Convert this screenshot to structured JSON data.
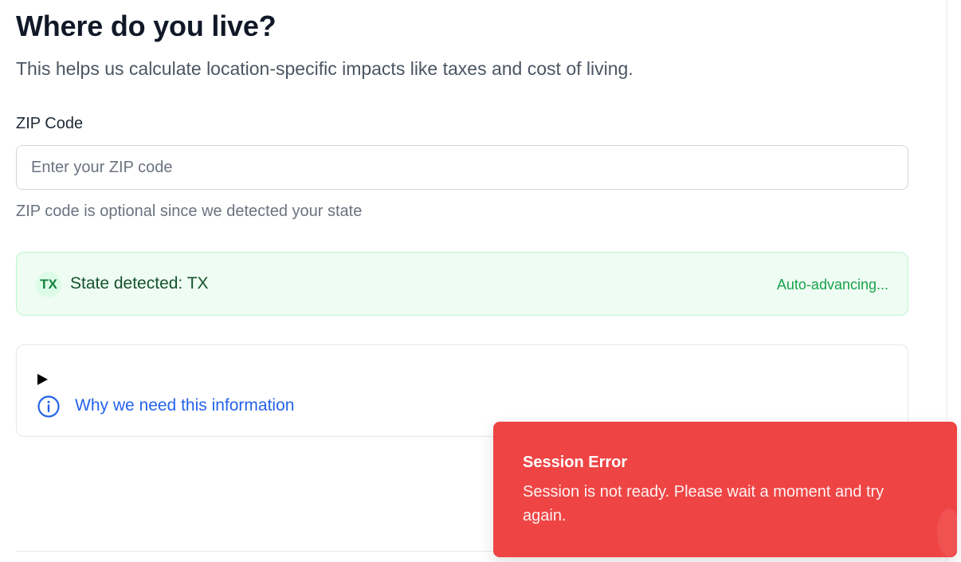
{
  "header": {
    "title": "Where do you live?",
    "subtitle": "This helps us calculate location-specific impacts like taxes and cost of living."
  },
  "zip": {
    "label": "ZIP Code",
    "placeholder": "Enter your ZIP code",
    "value": "",
    "helper": "ZIP code is optional since we detected your state"
  },
  "state_detected": {
    "badge": "TX",
    "text": "State detected: TX",
    "status": "Auto-advancing..."
  },
  "info": {
    "toggle_icon": "play-triangle-icon",
    "icon": "info-circle-icon",
    "link_text": "Why we need this information"
  },
  "toast": {
    "title": "Session Error",
    "message": "Session is not ready. Please wait a moment and try again."
  },
  "colors": {
    "accent_link": "#2563eb",
    "success_bg": "#effcf3",
    "success_text": "#15803d",
    "error_bg": "#ef4444"
  }
}
